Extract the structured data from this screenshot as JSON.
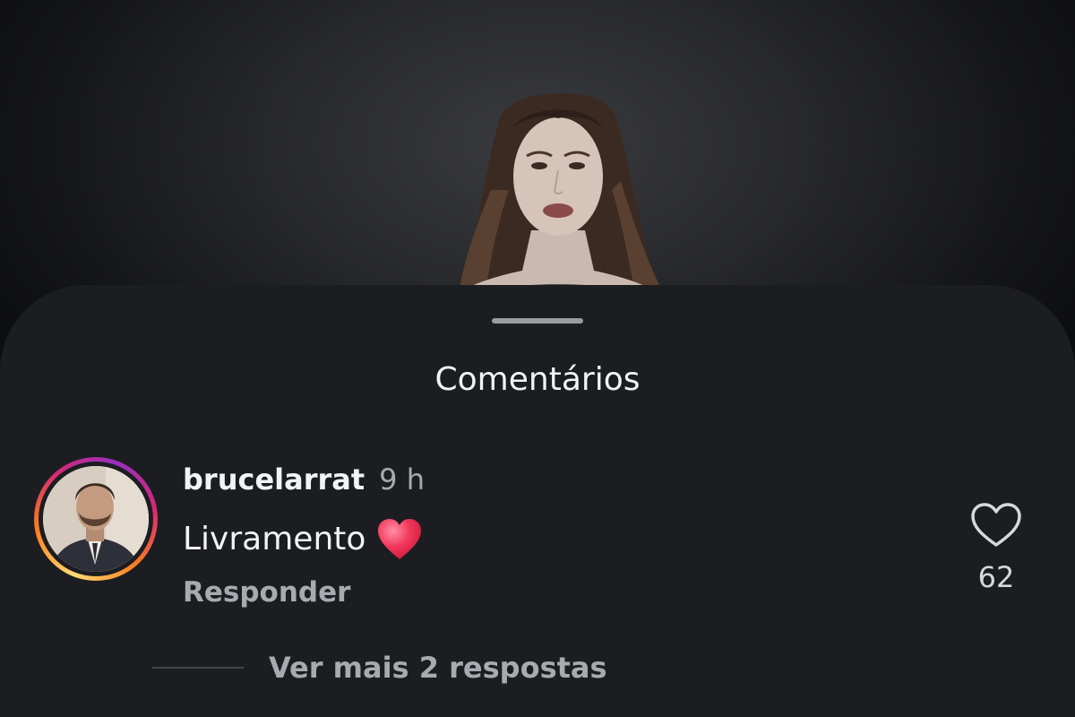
{
  "sheet": {
    "title": "Comentários"
  },
  "comment": {
    "username": "brucelarrat",
    "time": "9 h",
    "text": "Livramento",
    "emoji": "heart-emoji",
    "reply_label": "Responder",
    "likes": "62",
    "more_replies_label": "Ver mais 2 respostas"
  },
  "icons": {
    "like": "heart-outline-icon",
    "emoji": "red-heart-emoji"
  },
  "colors": {
    "sheet_bg": "#1b1d21",
    "text_primary": "#f2f3f5",
    "text_secondary": "#a8aab0",
    "story_ring_start": "#feda75",
    "story_ring_end": "#962fbf",
    "heart_red": "#f2375a"
  }
}
